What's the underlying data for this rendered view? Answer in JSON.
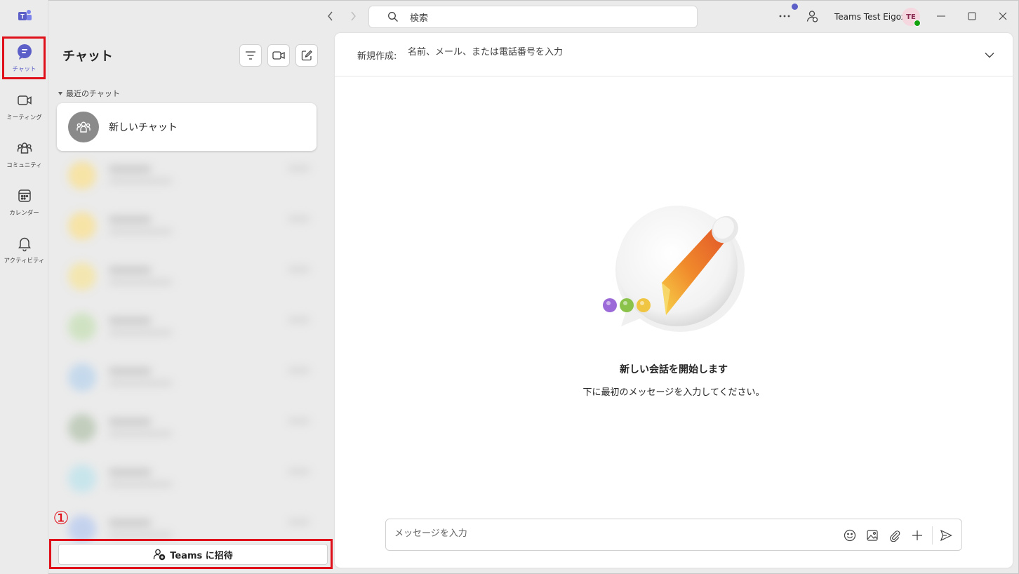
{
  "rail": {
    "items": [
      {
        "label": "チャット",
        "icon": "chat-icon",
        "active": true
      },
      {
        "label": "ミーティング",
        "icon": "video-icon"
      },
      {
        "label": "コミュニティ",
        "icon": "community-icon"
      },
      {
        "label": "カレンダー",
        "icon": "calendar-icon"
      },
      {
        "label": "アクティビティ",
        "icon": "bell-icon"
      }
    ]
  },
  "titlebar": {
    "search_placeholder": "検索",
    "username": "Teams Test Eigox",
    "avatar_initials": "TE"
  },
  "chatlist": {
    "title": "チャット",
    "section": "最近のチャット",
    "new_chat_label": "新しいチャット",
    "invite_label": "Teams に招待",
    "step_marker": "①"
  },
  "main": {
    "to_label": "新規作成:",
    "to_placeholder": "名前、メール、または電話番号を入力",
    "empty_title": "新しい会話を開始します",
    "empty_subtitle": "下に最初のメッセージを入力してください。",
    "compose_placeholder": "メッセージを入力"
  },
  "colors": {
    "accent": "#5b5fc7",
    "highlight": "#e0101a"
  }
}
